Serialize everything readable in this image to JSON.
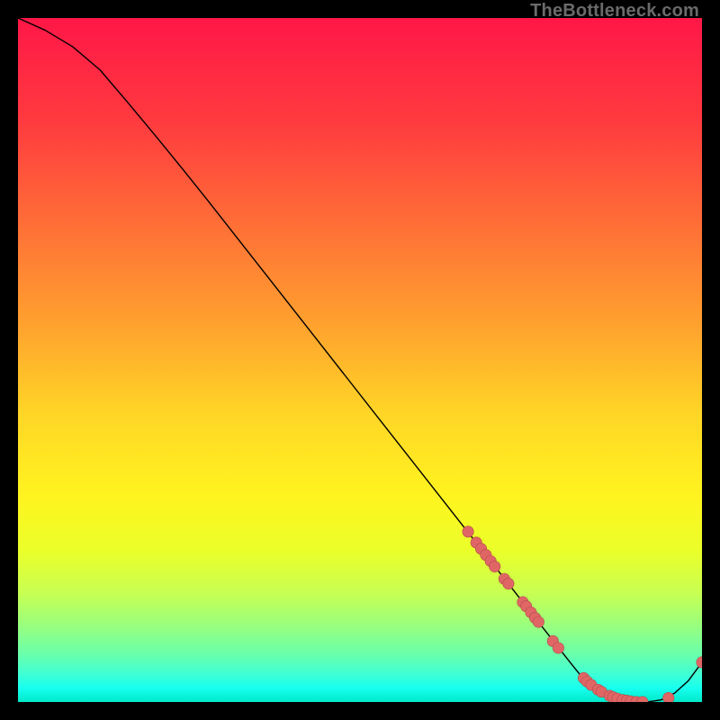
{
  "watermark": "TheBottleneck.com",
  "colors": {
    "dot_fill": "#e06666",
    "dot_stroke": "#b24a4a",
    "curve": "#000000"
  },
  "chart_data": {
    "type": "line",
    "title": "",
    "xlabel": "",
    "ylabel": "",
    "xlim": [
      0,
      100
    ],
    "ylim": [
      0,
      100
    ],
    "grid": false,
    "series": [
      {
        "name": "curve",
        "x": [
          0,
          4,
          8,
          12,
          16,
          20,
          24,
          28,
          32,
          36,
          40,
          44,
          48,
          52,
          56,
          60,
          64,
          68,
          72,
          76,
          80,
          82,
          84,
          86,
          88,
          90,
          92,
          94,
          96,
          98,
          100
        ],
        "y": [
          100,
          98.2,
          95.8,
          92.4,
          87.7,
          82.9,
          78.0,
          73.0,
          67.9,
          62.8,
          57.7,
          52.6,
          47.5,
          42.4,
          37.3,
          32.2,
          27.1,
          22.0,
          16.9,
          11.8,
          6.7,
          4.2,
          2.2,
          1.0,
          0.4,
          0.1,
          0.0,
          0.3,
          1.3,
          3.1,
          5.8
        ]
      }
    ],
    "cluster_points": {
      "name": "cluster",
      "points": [
        {
          "x": 65.8,
          "y": 24.9
        },
        {
          "x": 67.0,
          "y": 23.3
        },
        {
          "x": 67.7,
          "y": 22.4
        },
        {
          "x": 68.4,
          "y": 21.5
        },
        {
          "x": 69.1,
          "y": 20.6
        },
        {
          "x": 69.7,
          "y": 19.8
        },
        {
          "x": 71.1,
          "y": 18.0
        },
        {
          "x": 71.7,
          "y": 17.3
        },
        {
          "x": 73.8,
          "y": 14.6
        },
        {
          "x": 74.3,
          "y": 14.0
        },
        {
          "x": 75.0,
          "y": 13.1
        },
        {
          "x": 75.6,
          "y": 12.3
        },
        {
          "x": 76.1,
          "y": 11.7
        },
        {
          "x": 78.2,
          "y": 8.9
        },
        {
          "x": 79.0,
          "y": 7.9
        },
        {
          "x": 82.7,
          "y": 3.5
        },
        {
          "x": 83.2,
          "y": 3.0
        },
        {
          "x": 83.8,
          "y": 2.5
        },
        {
          "x": 84.8,
          "y": 1.8
        },
        {
          "x": 85.3,
          "y": 1.5
        },
        {
          "x": 86.5,
          "y": 0.9
        },
        {
          "x": 87.0,
          "y": 0.7
        },
        {
          "x": 87.6,
          "y": 0.5
        },
        {
          "x": 88.4,
          "y": 0.3
        },
        {
          "x": 89.0,
          "y": 0.2
        },
        {
          "x": 89.6,
          "y": 0.1
        },
        {
          "x": 90.4,
          "y": 0.0
        },
        {
          "x": 91.3,
          "y": 0.0
        },
        {
          "x": 95.1,
          "y": 0.6
        },
        {
          "x": 100.0,
          "y": 5.8
        }
      ]
    }
  }
}
